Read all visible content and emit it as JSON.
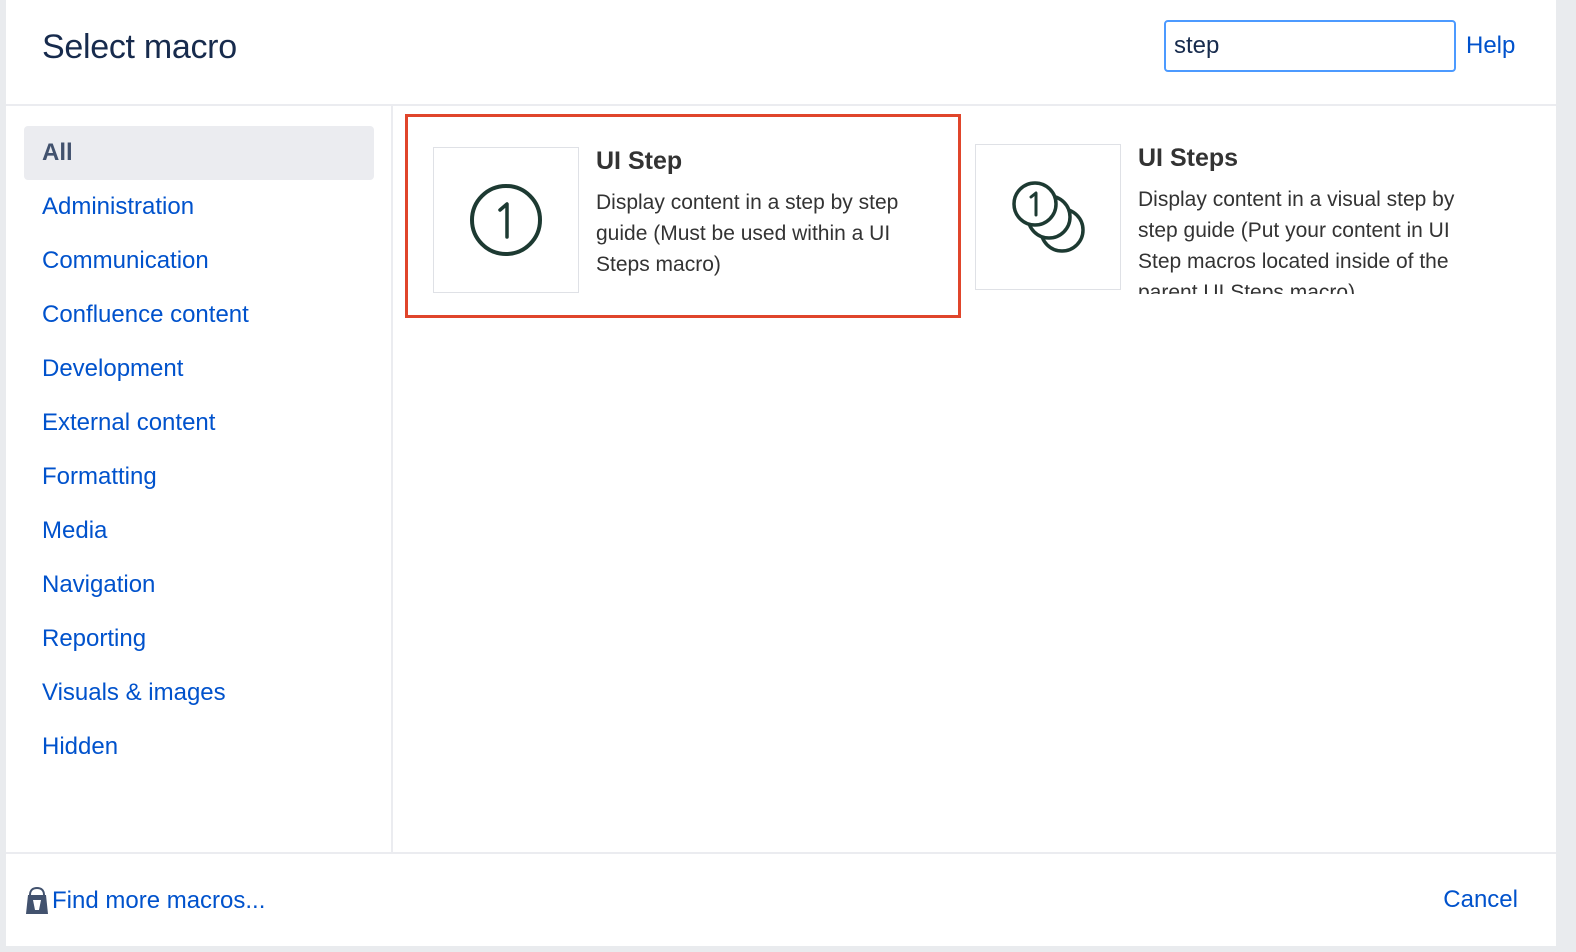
{
  "dialog": {
    "title": "Select macro",
    "search": {
      "value": "step",
      "placeholder": ""
    },
    "help_label": "Help"
  },
  "sidebar": {
    "items": [
      {
        "label": "All",
        "active": true
      },
      {
        "label": "Administration"
      },
      {
        "label": "Communication"
      },
      {
        "label": "Confluence content"
      },
      {
        "label": "Development"
      },
      {
        "label": "External content"
      },
      {
        "label": "Formatting"
      },
      {
        "label": "Media"
      },
      {
        "label": "Navigation"
      },
      {
        "label": "Reporting"
      },
      {
        "label": "Visuals & images"
      },
      {
        "label": "Hidden"
      }
    ]
  },
  "macros": [
    {
      "name": "UI Step",
      "description": "Display content in a step by step guide (Must be used within a UI Steps macro)",
      "icon": "single-step-icon",
      "selected": true
    },
    {
      "name": "UI Steps",
      "description": "Display content in a visual step by step guide (Put your content in UI Step macros located inside of the parent UI Steps macro)",
      "icon": "multi-step-icon",
      "selected": false
    }
  ],
  "footer": {
    "find_more_label": "Find more macros...",
    "cancel_label": "Cancel"
  },
  "colors": {
    "accent": "#0052cc",
    "selection": "#e0452b",
    "icon": "#1d3a32",
    "focus": "#4c9aff"
  }
}
